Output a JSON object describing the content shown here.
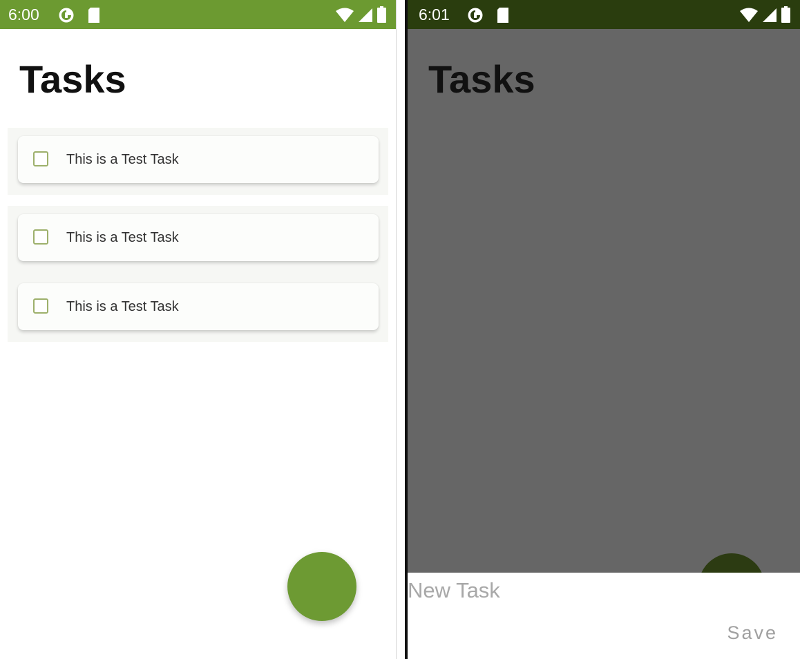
{
  "screens": [
    {
      "status_bar": {
        "time": "6:00"
      },
      "title": "Tasks",
      "groups": [
        {
          "tasks": [
            {
              "label": "This is a Test Task",
              "checked": false
            }
          ]
        },
        {
          "tasks": [
            {
              "label": "This is a Test Task",
              "checked": false
            },
            {
              "label": "This is a Test Task",
              "checked": false
            }
          ]
        }
      ],
      "fab": {
        "icon": "add-task-fab"
      }
    },
    {
      "status_bar": {
        "time": "6:01"
      },
      "title": "Tasks",
      "sheet": {
        "placeholder": "New Task",
        "value": "",
        "save_label": "Save"
      }
    }
  ],
  "colors": {
    "primary": "#6c9a31",
    "primary_dark": "#2a3d0e",
    "scrim": "#666666",
    "checkbox_border": "#9db06b"
  },
  "icons": [
    "data-saver-icon",
    "sd-card-icon",
    "wifi-icon",
    "cell-signal-icon",
    "battery-icon"
  ]
}
